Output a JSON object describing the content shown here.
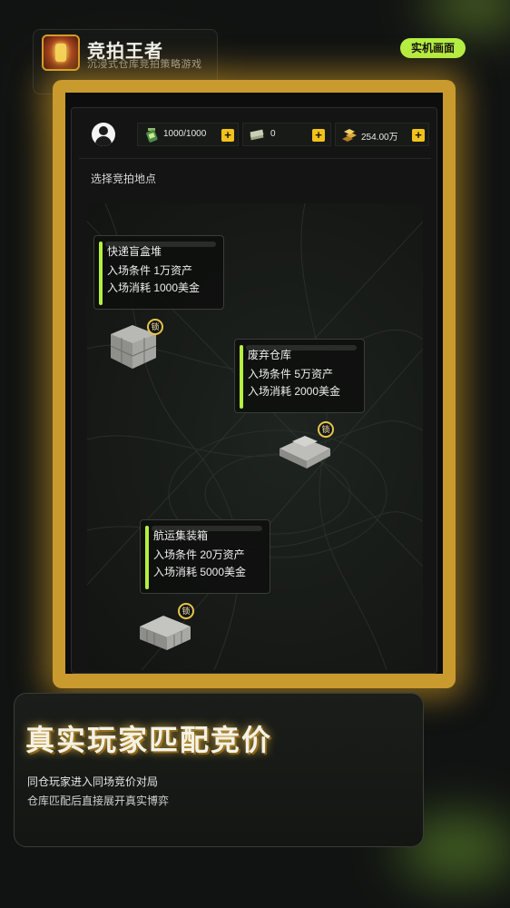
{
  "app": {
    "title": "竞拍王者",
    "subtitle": "沉浸式仓库竞拍策略游戏",
    "badge": "实机画面"
  },
  "stats": {
    "energy": "1000/1000",
    "cash": "0",
    "gold": "254.00万",
    "plus": "+"
  },
  "map_label": "选择竞拍地点",
  "locations": [
    {
      "name": "快递盲盒堆",
      "entry": "入场条件 1万资产",
      "cost": "入场消耗 1000美金",
      "lock": "锁"
    },
    {
      "name": "废弃仓库",
      "entry": "入场条件 5万资产",
      "cost": "入场消耗 2000美金",
      "lock": "锁"
    },
    {
      "name": "航运集装箱",
      "entry": "入场条件 20万资产",
      "cost": "入场消耗 5000美金",
      "lock": "锁"
    }
  ],
  "feature": {
    "title": "真实玩家匹配竞价",
    "line1": "同仓玩家进入同场竞价对局",
    "line2": "仓库匹配后直接展开真实博弈"
  },
  "colors": {
    "accent_green": "#b4ef43",
    "accent_gold": "#e0a828",
    "plus_yellow": "#f2c21b"
  }
}
